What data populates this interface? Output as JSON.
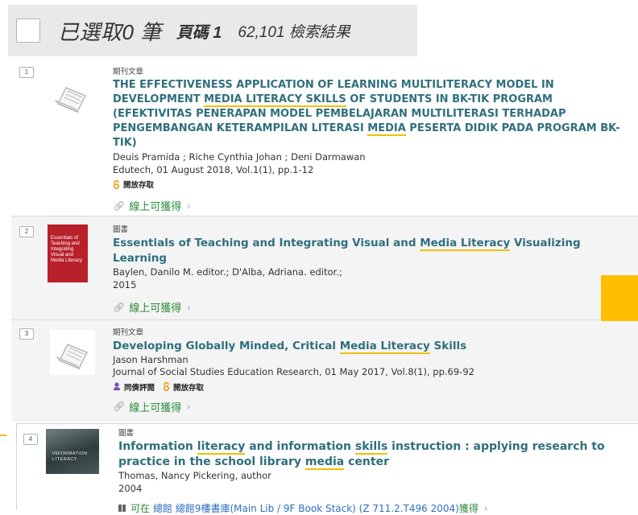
{
  "header": {
    "selected_count": "已選取0 筆",
    "page_label": "頁碼 1",
    "results_count": "62,101 檢索結果"
  },
  "items": [
    {
      "number": "1",
      "type": "期刊文章",
      "thumbnail": "article-icon",
      "title_parts": [
        {
          "t": "THE EFFECTIVENESS APPLICATION OF LEARNING MULTILITERACY MODEL IN DEVELOPMENT "
        },
        {
          "t": "MEDIA LITERACY SKILLS",
          "hl": true
        },
        {
          "t": " OF STUDENTS IN BK-TIK PROGRAM (EFEKTIVITAS PENERAPAN MODEL PEMBELAJARAN MULTILITERASI TERHADAP PENGEMBANGAN KETERAMPILAN LITERASI "
        },
        {
          "t": "MEDIA",
          "hl": true
        },
        {
          "t": " PESERTA DIDIK PADA PROGRAM BK-TIK)"
        }
      ],
      "authors": "Deuis Pramida ; Riche Cynthia Johan ; Deni Darmawan",
      "source": "Edutech, 01 August 2018, Vol.1(1), pp.1-12",
      "badges": [
        {
          "icon": "open-access-icon",
          "label": "開放存取"
        }
      ],
      "online": "線上可獲得"
    },
    {
      "number": "2",
      "type": "圖書",
      "thumbnail": "book-cover",
      "cover_text": "Essentials of Teaching and Integrating Visual and Media Literacy",
      "title_parts": [
        {
          "t": "Essentials of Teaching and Integrating Visual and "
        },
        {
          "t": "Media Literacy",
          "hl": true
        },
        {
          "t": " Visualizing Learning"
        }
      ],
      "authors": "Baylen, Danilo M. editor.; D'Alba, Adriana. editor.;",
      "year": "2015",
      "online": "線上可獲得"
    },
    {
      "number": "3",
      "type": "期刊文章",
      "thumbnail": "article-icon",
      "title_parts": [
        {
          "t": "Developing Globally Minded, Critical "
        },
        {
          "t": "Media Literacy",
          "hl": true
        },
        {
          "t": " Skills"
        }
      ],
      "authors": "Jason Harshman",
      "source": "Journal of Social Studies Education Research, 01 May 2017, Vol.8(1), pp.69-92",
      "badges": [
        {
          "icon": "peer-reviewed-icon",
          "label": "同儕評閱"
        },
        {
          "icon": "open-access-icon",
          "label": "開放存取"
        }
      ],
      "online": "線上可獲得"
    },
    {
      "number": "4",
      "type": "圖書",
      "thumbnail": "book-cover-photo",
      "cover_text": "INFORMATION LITERACY",
      "title_parts": [
        {
          "t": "Information "
        },
        {
          "t": "literacy",
          "hl": true
        },
        {
          "t": " and information "
        },
        {
          "t": "skills",
          "hl": true
        },
        {
          "t": " instruction : applying research to practice in the school library "
        },
        {
          "t": "media",
          "hl": true
        },
        {
          "t": " center"
        }
      ],
      "authors": "Thomas, Nancy Pickering, author",
      "year": "2004",
      "location": {
        "icon": "book-icon",
        "status": "可在",
        "text": "總館  總館9樓書庫(Main Lib / 9F Book Stack) (Z 711.2.T496 2004)",
        "suffix": "獲得"
      }
    }
  ],
  "colors": {
    "title": "#2f6f7e",
    "highlight": "#f0c000",
    "online": "#2a8b3a",
    "open_access": "#f29400",
    "peer_reviewed": "#7a4bb0",
    "accent_block": "#ffbe00"
  }
}
